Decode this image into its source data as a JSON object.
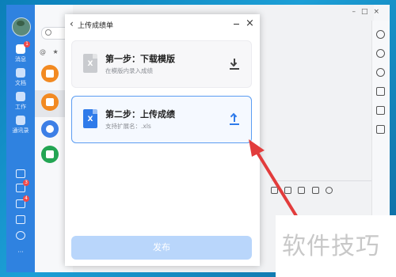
{
  "nav": {
    "items": [
      {
        "label": "消息",
        "badge": "1"
      },
      {
        "label": "文档"
      },
      {
        "label": "工作"
      },
      {
        "label": "通讯录"
      }
    ],
    "bottom_badges": [
      "3",
      "4"
    ]
  },
  "contacts": {
    "search_icon": "search-icon",
    "filter_at": "@",
    "filter_star": "★"
  },
  "dialog": {
    "back": "‹",
    "title": "上传成绩单",
    "close": "×",
    "step1": {
      "title": "第一步：下载模版",
      "subtitle": "在模版内录入成绩",
      "file_glyph": "X",
      "action_icon": "download-icon"
    },
    "step2": {
      "title": "第二步：上传成绩",
      "subtitle": "支持扩展名：.xls",
      "file_glyph": "X",
      "action_icon": "upload-icon"
    },
    "publish_label": "发布"
  },
  "watermark": {
    "text": "软件技巧"
  },
  "colors": {
    "primary": "#2f82e0",
    "accent_border": "#5b9df2",
    "publish_disabled": "#b9d6fb",
    "annotation_arrow": "#e23c3c",
    "contact_orange": "#f28a22",
    "contact_blue": "#3d7fe6",
    "contact_green": "#23a553"
  }
}
